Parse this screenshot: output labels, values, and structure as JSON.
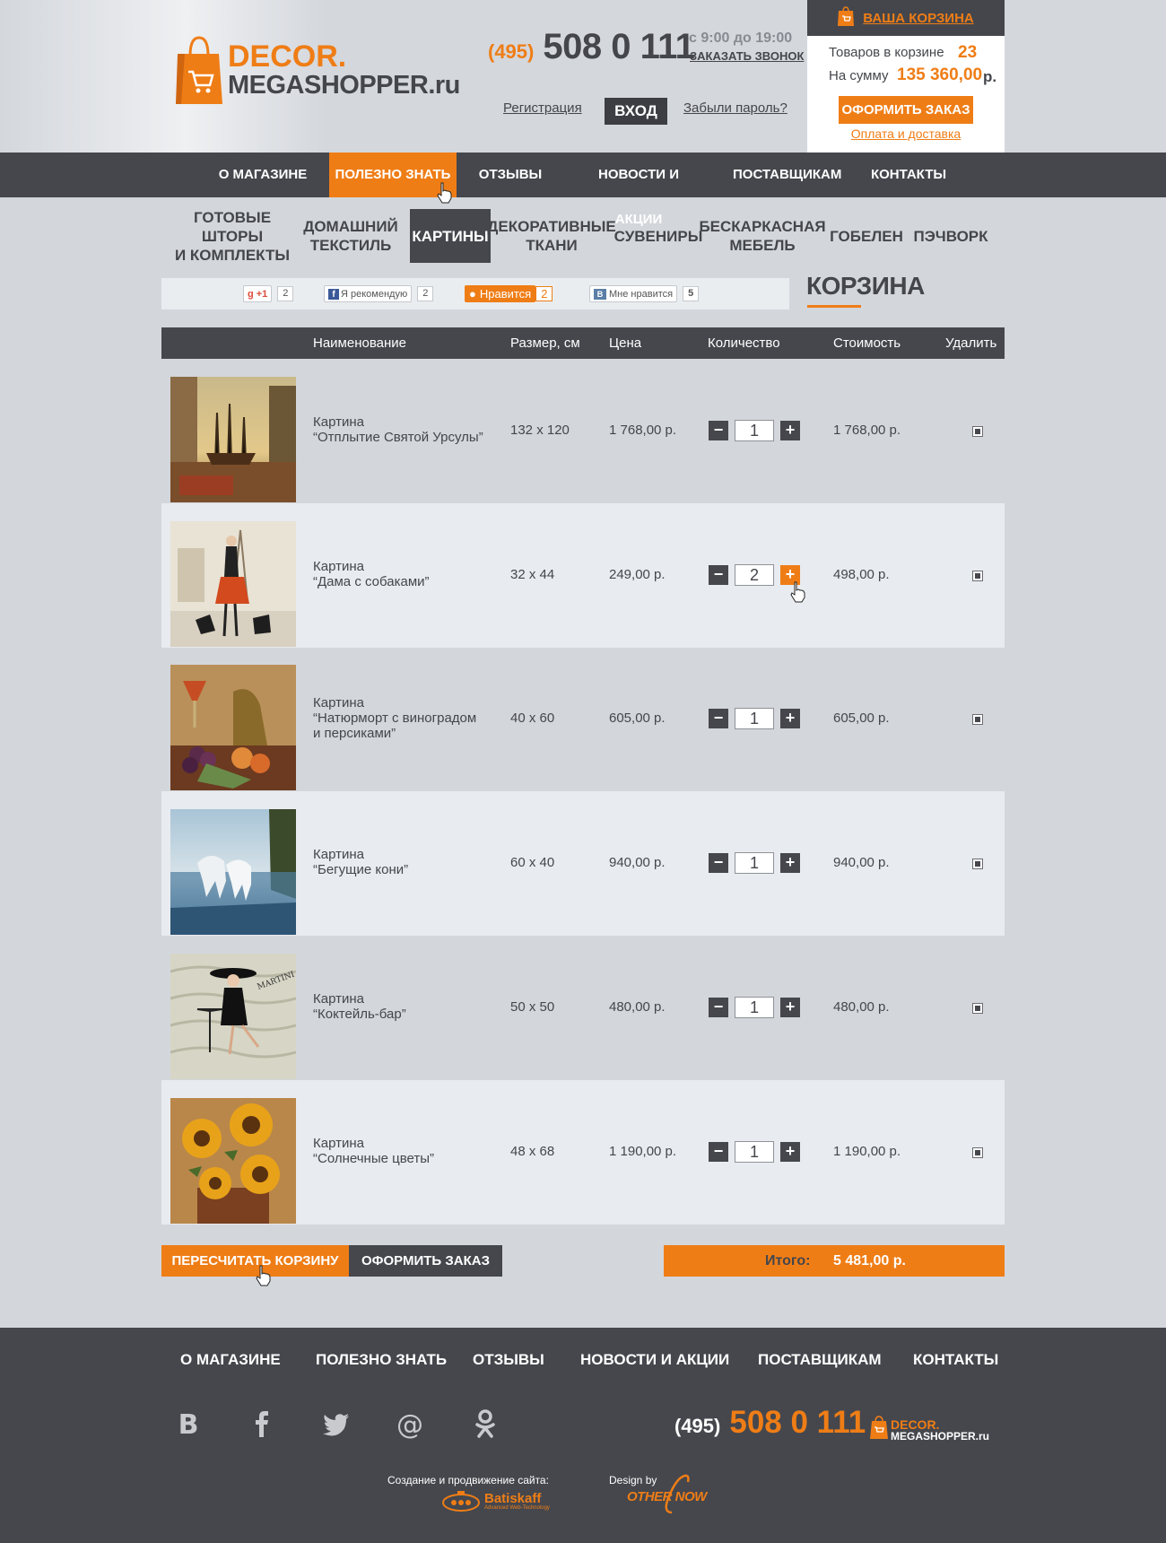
{
  "header": {
    "logo": {
      "line1": "DECOR.",
      "line2": "MEGASHOPPER.ru"
    },
    "phone": {
      "code": "(495)",
      "number": "508 0 111"
    },
    "hours": "с 9:00 до 19:00",
    "callback": "ЗАКАЗАТЬ ЗВОНОК",
    "register": "Регистрация",
    "login": "ВХОД",
    "forgot": "Забыли пароль?"
  },
  "cart_widget": {
    "title": "ВАША КОРЗИНА",
    "items_label": "Товаров в корзине",
    "items_count": "23",
    "sum_label": "На сумму",
    "sum_value": "135 360,00",
    "sum_currency": "р.",
    "order_button": "ОФОРМИТЬ ЗАКАЗ",
    "payment_link": "Оплата и доставка"
  },
  "top_nav": [
    {
      "label": "О МАГАЗИНЕ"
    },
    {
      "label": "ПОЛЕЗНО ЗНАТЬ",
      "active": true
    },
    {
      "label": "ОТЗЫВЫ"
    },
    {
      "label": "НОВОСТИ И АКЦИИ"
    },
    {
      "label": "ПОСТАВЩИКАМ"
    },
    {
      "label": "КОНТАКТЫ"
    }
  ],
  "categories": [
    {
      "line1": "ГОТОВЫЕ ШТОРЫ",
      "line2": "И КОМПЛЕКТЫ"
    },
    {
      "line1": "ДОМАШНИЙ",
      "line2": "ТЕКСТИЛЬ"
    },
    {
      "line1": "КАРТИНЫ",
      "line2": "",
      "active": true
    },
    {
      "line1": "ДЕКОРАТИВНЫЕ",
      "line2": "ТКАНИ"
    },
    {
      "line1": "СУВЕНИРЫ",
      "line2": ""
    },
    {
      "line1": "БЕСКАРКАСНАЯ",
      "line2": "МЕБЕЛЬ"
    },
    {
      "line1": "ГОБЕЛЕН",
      "line2": ""
    },
    {
      "line1": "ПЭЧВОРК",
      "line2": ""
    }
  ],
  "social": {
    "gplus": {
      "label": "+1",
      "count": "2"
    },
    "facebook": {
      "label": "Я рекомендую",
      "count": "2"
    },
    "ok": {
      "label": "Нравится",
      "count": "2"
    },
    "vk": {
      "label": "Мне нравится",
      "count": "5"
    }
  },
  "page_title": "КОРЗИНА",
  "table": {
    "headers": {
      "name": "Наименование",
      "size": "Размер, см",
      "price": "Цена",
      "qty": "Количество",
      "cost": "Стоимость",
      "delete": "Удалить"
    },
    "rows": [
      {
        "type": "Картина",
        "name": "“Отплытие Святой Урсулы”",
        "name2": "",
        "size": "132 х 120",
        "price": "1 768,00 р.",
        "qty": "1",
        "cost": "1 768,00 р."
      },
      {
        "type": "Картина",
        "name": "“Дама с собаками”",
        "name2": "",
        "size": "32 х 44",
        "price": "249,00 р.",
        "qty": "2",
        "cost": "498,00 р."
      },
      {
        "type": "Картина",
        "name": "“Натюрморт с виноградом",
        "name2": "и персиками”",
        "size": "40 х 60",
        "price": "605,00 р.",
        "qty": "1",
        "cost": "605,00 р."
      },
      {
        "type": "Картина",
        "name": "“Бегущие кони”",
        "name2": "",
        "size": "60 х 40",
        "price": "940,00 р.",
        "qty": "1",
        "cost": "940,00 р."
      },
      {
        "type": "Картина",
        "name": "“Коктейль-бар”",
        "name2": "",
        "size": "50 х 50",
        "price": "480,00 р.",
        "qty": "1",
        "cost": "480,00 р."
      },
      {
        "type": "Картина",
        "name": "“Солнечные цветы”",
        "name2": "",
        "size": "48 х 68",
        "price": "1 190,00 р.",
        "qty": "1",
        "cost": "1 190,00 р."
      }
    ]
  },
  "actions": {
    "recalc": "ПЕРЕСЧИТАТЬ КОРЗИНУ",
    "order": "ОФОРМИТЬ ЗАКАЗ",
    "total_label": "Итого:",
    "total_value": "5 481,00 р."
  },
  "footer": {
    "nav": [
      "О МАГАЗИНЕ",
      "ПОЛЕЗНО ЗНАТЬ",
      "ОТЗЫВЫ",
      "НОВОСТИ И АКЦИИ",
      "ПОСТАВЩИКАМ",
      "КОНТАКТЫ"
    ],
    "social_icons": [
      "vk-icon",
      "facebook-icon",
      "twitter-icon",
      "mail-icon",
      "odnoklassniki-icon"
    ],
    "phone": {
      "code": "(495)",
      "number": "508 0 111"
    },
    "logo": {
      "line1": "DECOR.",
      "line2": "MEGASHOPPER.ru"
    },
    "credit1": "Создание и продвижение сайта:",
    "credit1_logo": "Batiskaff",
    "credit1_tag": "Advanced Web-Technology",
    "credit2": "Design by",
    "credit2_logo": "OTHER NOW"
  },
  "colors": {
    "accent": "#ef7d16",
    "dark": "#45474d",
    "bg": "#d3d6db",
    "row_alt": "#e8ebef"
  }
}
